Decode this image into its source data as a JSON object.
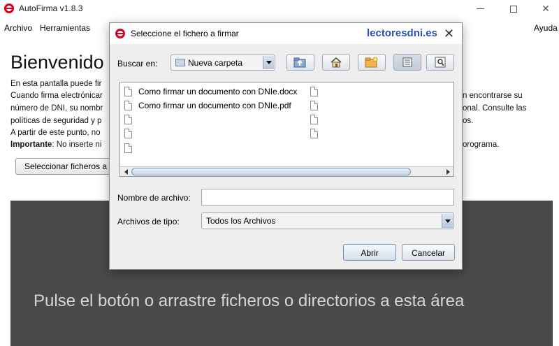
{
  "window": {
    "title": "AutoFirma v1.8.3",
    "controls": {
      "minimize": "─",
      "close": "✕"
    }
  },
  "menu": {
    "file": "Archivo",
    "tools": "Herramientas",
    "help": "Ayuda"
  },
  "main": {
    "welcome": "Bienvenido",
    "lines": [
      "En esta pantalla puede fir",
      "Cuando firma electrónicar",
      "número de DNI, su nombr",
      "políticas de seguridad y p",
      "A partir de este punto, no"
    ],
    "important_label": "Importante",
    "important_text": ": No inserte ni",
    "right_fragments": [
      "n encontrarse su",
      "onal. Consulte las",
      "os.",
      "orograma."
    ],
    "select_button": "Seleccionar ficheros a",
    "drop_hint": "Pulse el botón o arrastre ficheros o directorios a esta área"
  },
  "dialog": {
    "title": "Seleccione el fichero a firmar",
    "watermark": "lectoresdni.es",
    "close": "✕",
    "look_in_label": "Buscar en:",
    "look_in_value": "Nueva carpeta",
    "files": [
      "Como firmar un documento con DNIe.docx",
      "Como firmar un documento con DNIe.pdf"
    ],
    "filename_label": "Nombre de archivo:",
    "filename_value": "",
    "filetype_label": "Archivos de tipo:",
    "filetype_value": "Todos los Archivos",
    "open_button": "Abrir",
    "cancel_button": "Cancelar",
    "toolbar_icons": [
      "up-folder-icon",
      "home-icon",
      "new-folder-icon",
      "list-view-icon",
      "details-view-icon"
    ]
  },
  "colors": {
    "accent": "#d6001c",
    "watermark": "#2a4fb6",
    "drop_area": "#4a4a4a"
  }
}
